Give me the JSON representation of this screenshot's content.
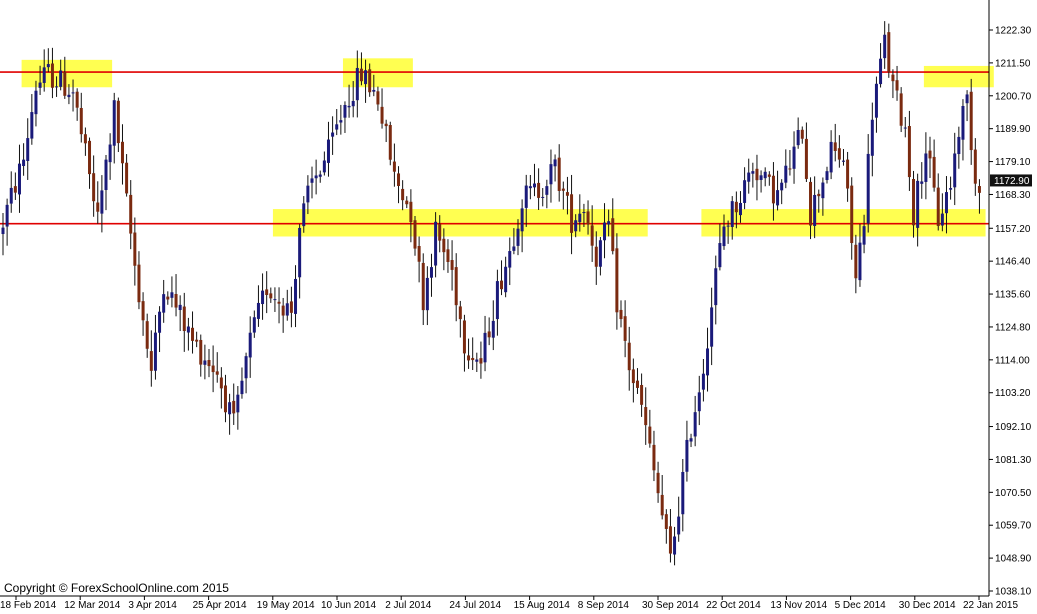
{
  "copyright": "Copyright © ForexSchoolOnline.com 2015",
  "current_price_label": "1172.90",
  "colors": {
    "bull": "#1a1a7a",
    "bear": "#7a2a10",
    "wick": "#111111",
    "resistance": "#e00000",
    "zone": "#ffff33",
    "price_box_bg": "#111111",
    "price_box_text": "#ffffff"
  },
  "chart_data": {
    "type": "candlestick",
    "title": "",
    "xlabel": "",
    "ylabel": "",
    "ylim": [
      1035.0,
      1228.0
    ],
    "y_ticks": [
      "1222.30",
      "1211.50",
      "1200.70",
      "1189.90",
      "1179.10",
      "1168.30",
      "1157.20",
      "1146.40",
      "1135.60",
      "1124.80",
      "1114.00",
      "1103.20",
      "1092.10",
      "1081.30",
      "1070.50",
      "1059.70",
      "1048.90",
      "1038.10"
    ],
    "x_ticks": [
      "18 Feb 2014",
      "12 Mar 2014",
      "3 Apr 2014",
      "25 Apr 2014",
      "19 May 2014",
      "10 Jun 2014",
      "2 Jul 2014",
      "24 Jul 2014",
      "15 Aug 2014",
      "8 Sep 2014",
      "30 Sep 2014",
      "22 Oct 2014",
      "13 Nov 2014",
      "5 Dec 2014",
      "30 Dec 2014",
      "22 Jan 2015"
    ],
    "horizontal_lines": [
      1208.5,
      1158.7
    ],
    "zones": [
      {
        "start": 5,
        "end": 26,
        "low": 1203.5,
        "high": 1212.5
      },
      {
        "start": 83,
        "end": 99,
        "low": 1203.5,
        "high": 1213.0
      },
      {
        "start": 66,
        "end": 156,
        "low": 1154.5,
        "high": 1163.5
      },
      {
        "start": 170,
        "end": 238,
        "low": 1154.5,
        "high": 1163.5
      },
      {
        "start": 224,
        "end": 240,
        "low": 1203.5,
        "high": 1210.5
      }
    ],
    "waypoints": [
      [
        0,
        1155
      ],
      [
        6,
        1180
      ],
      [
        9,
        1204
      ],
      [
        12,
        1208
      ],
      [
        18,
        1202
      ],
      [
        24,
        1160
      ],
      [
        28,
        1196
      ],
      [
        33,
        1145
      ],
      [
        37,
        1110
      ],
      [
        40,
        1140
      ],
      [
        47,
        1120
      ],
      [
        53,
        1110
      ],
      [
        57,
        1092
      ],
      [
        61,
        1120
      ],
      [
        65,
        1138
      ],
      [
        71,
        1130
      ],
      [
        73,
        1158
      ],
      [
        76,
        1172
      ],
      [
        80,
        1182
      ],
      [
        84,
        1198
      ],
      [
        88,
        1208
      ],
      [
        92,
        1200
      ],
      [
        96,
        1174
      ],
      [
        100,
        1163
      ],
      [
        103,
        1134
      ],
      [
        106,
        1156
      ],
      [
        110,
        1143
      ],
      [
        113,
        1120
      ],
      [
        117,
        1113
      ],
      [
        121,
        1137
      ],
      [
        124,
        1150
      ],
      [
        127,
        1167
      ],
      [
        131,
        1170
      ],
      [
        135,
        1177
      ],
      [
        139,
        1160
      ],
      [
        142,
        1165
      ],
      [
        145,
        1148
      ],
      [
        148,
        1158
      ],
      [
        150,
        1133
      ],
      [
        153,
        1112
      ],
      [
        156,
        1098
      ],
      [
        160,
        1070
      ],
      [
        163,
        1048
      ],
      [
        166,
        1075
      ],
      [
        168,
        1092
      ],
      [
        171,
        1112
      ],
      [
        174,
        1142
      ],
      [
        176,
        1158
      ],
      [
        180,
        1168
      ],
      [
        183,
        1178
      ],
      [
        186,
        1172
      ],
      [
        189,
        1168
      ],
      [
        192,
        1178
      ],
      [
        195,
        1190
      ],
      [
        197,
        1162
      ],
      [
        200,
        1174
      ],
      [
        202,
        1182
      ],
      [
        205,
        1180
      ],
      [
        208,
        1140
      ],
      [
        210,
        1162
      ],
      [
        212,
        1196
      ],
      [
        215,
        1218
      ],
      [
        217,
        1203
      ],
      [
        220,
        1190
      ],
      [
        222,
        1162
      ],
      [
        225,
        1184
      ],
      [
        228,
        1160
      ],
      [
        231,
        1172
      ],
      [
        233,
        1190
      ],
      [
        235,
        1200
      ],
      [
        237,
        1173
      ]
    ],
    "candle_count": 238
  }
}
